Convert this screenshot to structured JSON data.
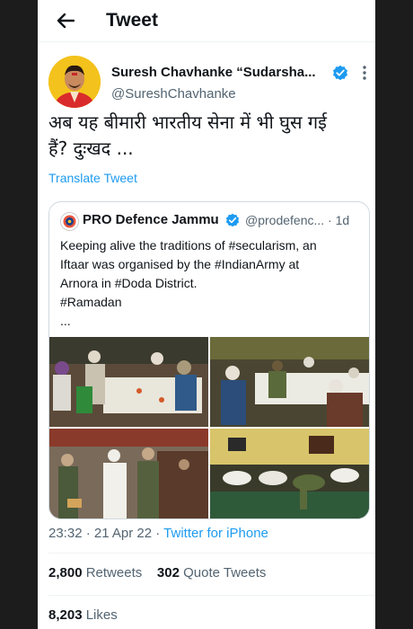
{
  "header": {
    "title": "Tweet"
  },
  "tweet": {
    "author_name": "Suresh Chavhanke “Sudarsha...",
    "handle": "@SureshChavhanke",
    "text_line1": "अब यह बीमारी भारतीय सेना में भी घुस गई",
    "text_line2": "हैं? दुःखद ...",
    "translate_label": "Translate Tweet",
    "date": "23:32 · 21 Apr 22 · ",
    "source": "Twitter for iPhone"
  },
  "quoted": {
    "name": "PRO Defence Jammu",
    "handle": "@prodefenc...",
    "age": "· 1d",
    "lines": [
      "Keeping alive the traditions of #secularism, an",
      "Iftaar was organised by the #IndianArmy at",
      "Arnora in #Doda District.",
      "#Ramadan",
      "..."
    ]
  },
  "stats": {
    "retweets": "2,800",
    "retweets_label": "Retweets",
    "quotes": "302",
    "quotes_label": "Quote Tweets",
    "likes": "8,203",
    "likes_label": "Likes"
  },
  "colors": {
    "link": "#1d9bf0",
    "verified": "#1d9bf0",
    "muted": "#536471",
    "text": "#0f1419"
  },
  "icons": [
    "back-arrow-icon",
    "verified-badge-icon",
    "more-icon"
  ]
}
